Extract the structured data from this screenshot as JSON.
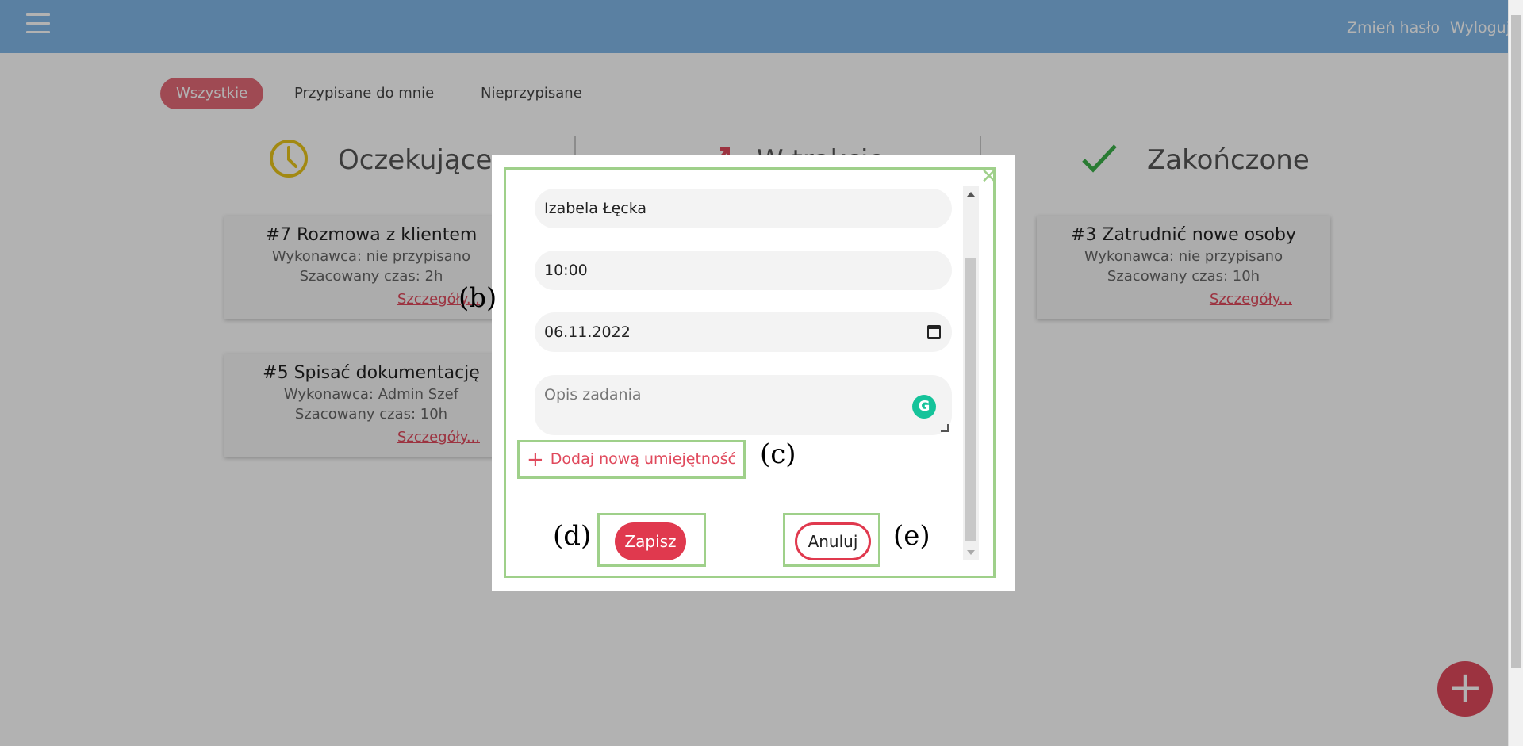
{
  "header": {
    "change_password": "Zmień hasło",
    "logout": "Wyloguj"
  },
  "filters": {
    "all": "Wszystkie",
    "assigned_to_me": "Przypisane do mnie",
    "unassigned": "Nieprzypisane"
  },
  "columns": {
    "pending": "Oczekujące",
    "in_progress": "W trakcie",
    "done": "Zakończone"
  },
  "cards": [
    {
      "title": "#7 Rozmowa z klientem",
      "assignee": "Wykonawca: nie przypisano",
      "estimate": "Szacowany czas: 2h",
      "details": "Szczegóły..."
    },
    {
      "title": "#5 Spisać dokumentację",
      "assignee": "Wykonawca: Admin Szef",
      "estimate": "Szacowany czas: 10h",
      "details": "Szczegóły..."
    },
    {
      "title": "#3 Zatrudnić nowe osoby",
      "assignee": "Wykonawca: nie przypisano",
      "estimate": "Szacowany czas: 10h",
      "details": "Szczegóły..."
    }
  ],
  "modal": {
    "assignee_value": "Izabela Łęcka",
    "time_value": "10:00",
    "date_value": "06.11.2022",
    "description_placeholder": "Opis zadania",
    "add_skill": "Dodaj nową umiejętność",
    "save": "Zapisz",
    "cancel": "Anuluj",
    "close_symbol": "✕"
  },
  "annotations": {
    "b": "(b)",
    "c": "(c)",
    "d": "(d)",
    "e": "(e)"
  },
  "fab_symbol": "+",
  "colors": {
    "topbar": "#82b8e8",
    "accent": "#e0495c",
    "annotation_frame": "#9fd08a",
    "pending_icon": "#e8c41a",
    "done_icon": "#3bb04a"
  }
}
